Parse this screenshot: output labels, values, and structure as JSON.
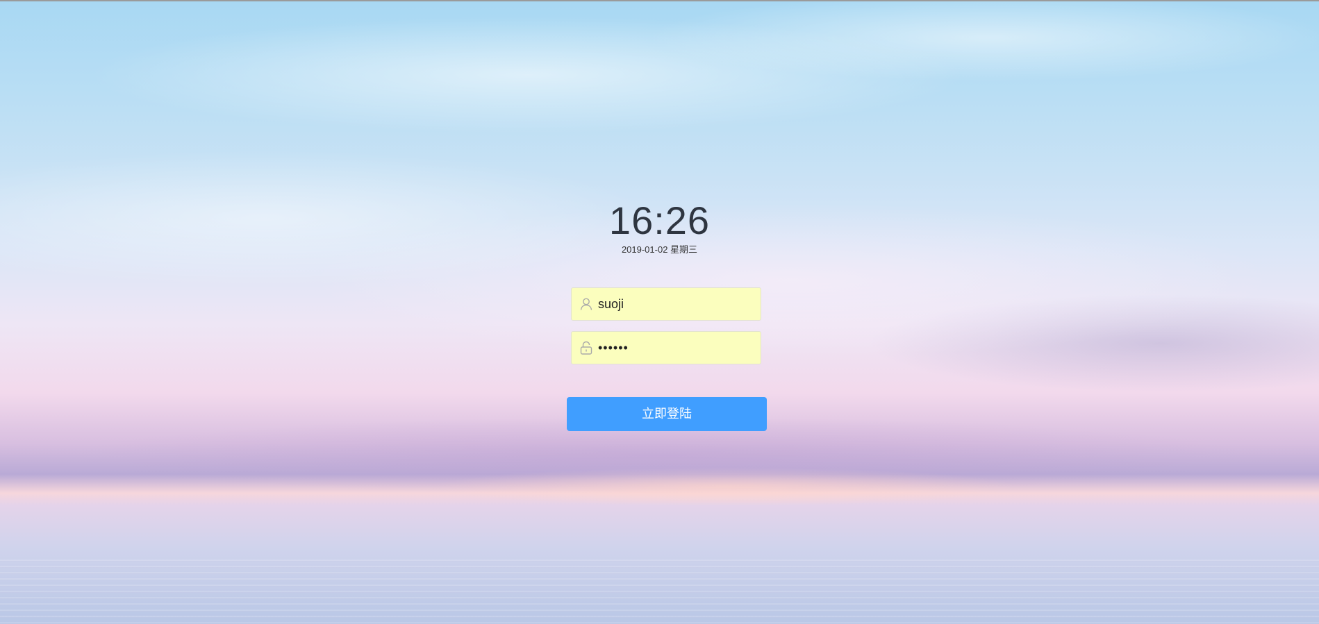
{
  "clock": {
    "time": "16:26",
    "date": "2019-01-02 星期三"
  },
  "login_form": {
    "username": {
      "value": "suoji",
      "icon": "user-icon"
    },
    "password": {
      "value": "••••••",
      "icon": "lock-icon"
    },
    "submit_label": "立即登陆"
  },
  "colors": {
    "input_background": "#fbfebe",
    "button_background": "#409eff",
    "clock_text": "#2e3540"
  }
}
